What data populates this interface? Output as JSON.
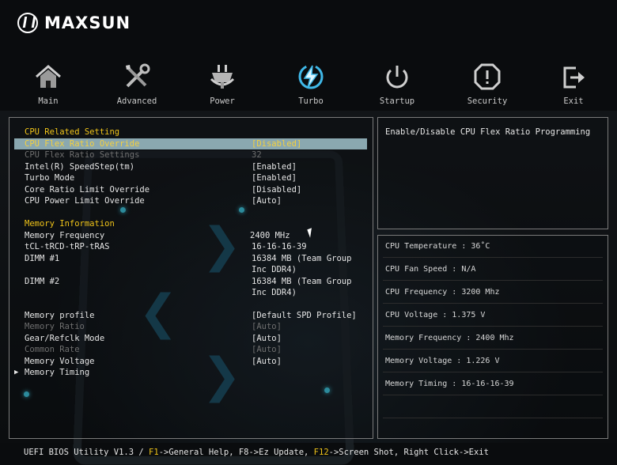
{
  "brand": {
    "name": "MAXSUN"
  },
  "nav": [
    {
      "label": "Main",
      "icon": "home-icon"
    },
    {
      "label": "Advanced",
      "icon": "tools-icon"
    },
    {
      "label": "Power",
      "icon": "power-plug-icon"
    },
    {
      "label": "Turbo",
      "icon": "turbo-bolt-icon",
      "active": true
    },
    {
      "label": "Startup",
      "icon": "startup-power-icon"
    },
    {
      "label": "Security",
      "icon": "shield-icon"
    },
    {
      "label": "Exit",
      "icon": "exit-icon"
    }
  ],
  "settings": {
    "cpu_section": "CPU Related Setting",
    "cpu_flex_ratio_override": {
      "label": "CPU Flex Ratio Override",
      "value": "[Disabled]"
    },
    "cpu_flex_ratio_settings": {
      "label": "CPU Flex Ratio Settings",
      "value": "32"
    },
    "speedstep": {
      "label": "Intel(R) SpeedStep(tm)",
      "value": "[Enabled]"
    },
    "turbo_mode": {
      "label": "Turbo Mode",
      "value": "[Enabled]"
    },
    "core_ratio_limit": {
      "label": "Core Ratio Limit Override",
      "value": "[Disabled]"
    },
    "cpu_power_limit": {
      "label": "CPU Power Limit Override",
      "value": "[Auto]"
    },
    "memory_section": "Memory Information",
    "memory_frequency": {
      "label": "Memory Frequency",
      "value": "2400 MHz"
    },
    "timings": {
      "label": "tCL-tRCD-tRP-tRAS",
      "value": "16-16-16-39"
    },
    "dimm1": {
      "label": "DIMM #1",
      "value_line1": "16384 MB (Team Group",
      "value_line2": "Inc DDR4)"
    },
    "dimm2": {
      "label": "DIMM #2",
      "value_line1": "16384 MB (Team Group",
      "value_line2": "Inc DDR4)"
    },
    "memory_profile": {
      "label": "Memory profile",
      "value": "[Default SPD Profile]"
    },
    "memory_ratio": {
      "label": "Memory Ratio",
      "value": "[Auto]"
    },
    "gear_refclk": {
      "label": "Gear/Refclk Mode",
      "value": "[Auto]"
    },
    "common_rate": {
      "label": "Common Rate",
      "value": "[Auto]"
    },
    "memory_voltage": {
      "label": "Memory Voltage",
      "value": "[Auto]"
    },
    "memory_timing": {
      "label": "Memory Timing"
    }
  },
  "help": {
    "text": "Enable/Disable CPU Flex Ratio Programming"
  },
  "info": [
    "CPU Temperature : 36˚C",
    "CPU Fan Speed : N/A",
    "CPU Frequency : 3200 Mhz",
    "CPU Voltage : 1.375 V",
    "Memory Frequency : 2400 Mhz",
    "Memory Voltage : 1.226 V",
    "Memory Timing : 16-16-16-39"
  ],
  "footer": {
    "prefix": "UEFI BIOS Utility V1.3 / ",
    "k1": "F1",
    "t1": "->General Help, F8->Ez Update, ",
    "k2": "F12",
    "t2": "->Screen Shot, Right Click->Exit"
  },
  "colors": {
    "accent": "#f0c419",
    "selected_bg": "#8aa8b0",
    "turbo": "#3fb8e8"
  }
}
